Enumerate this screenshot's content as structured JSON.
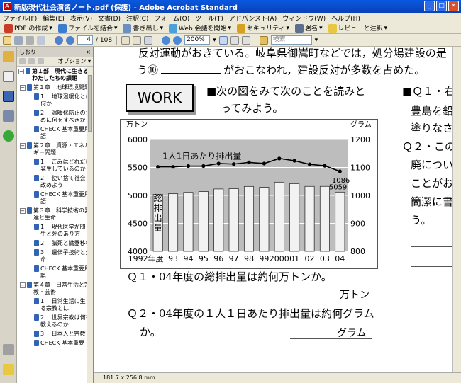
{
  "window": {
    "title": "新版現代社会演習ノート.pdf (保護) - Adobe Acrobat Standard",
    "buttons": [
      "_",
      "□",
      "×"
    ]
  },
  "menu": [
    "ファイル(F)",
    "編集(E)",
    "表示(V)",
    "文書(D)",
    "注釈(C)",
    "フォーム(O)",
    "ツール(T)",
    "アドバンスト(A)",
    "ウィンドウ(W)",
    "ヘルプ(H)"
  ],
  "toolbar1": {
    "pdf_create": "PDF の作成",
    "combine": "ファイルを結合",
    "export": "書き出し",
    "web_meeting": "Web 会議を開始",
    "security": "セキュリティ",
    "sign": "署名",
    "review": "レビューと注釈"
  },
  "toolbar2": {
    "page_current": "4",
    "page_total": "/ 108",
    "zoom": "200%",
    "search_placeholder": "検索"
  },
  "bookmarks": {
    "title": "しおり",
    "options": "オプション",
    "items": [
      {
        "level": 0,
        "text": "第１部　現代に生きるわたしたちの課題"
      },
      {
        "level": 1,
        "text": "第１章　地球環境問題"
      },
      {
        "level": 2,
        "text": "1.　地球温暖化とは何か"
      },
      {
        "level": 2,
        "text": "2.　温暖化防止のために何をすべきか"
      },
      {
        "level": 2,
        "text": "CHECK 基本重要用語"
      },
      {
        "level": 1,
        "text": "第２章　資源・エネルギー問題"
      },
      {
        "level": 2,
        "text": "1.　ごみはどれだけ発生しているのか"
      },
      {
        "level": 2,
        "text": "2.　使い捨て社会を改めよう"
      },
      {
        "level": 2,
        "text": "CHECK 基本重要用語"
      },
      {
        "level": 1,
        "text": "第３章　科学技術の発達と生命"
      },
      {
        "level": 2,
        "text": "1.　現代医学が問う生と死のあり方"
      },
      {
        "level": 2,
        "text": "2.　脳死と臓器移植"
      },
      {
        "level": 2,
        "text": "3.　遺伝子技術と生命"
      },
      {
        "level": 2,
        "text": "CHECK 基本重要用語"
      },
      {
        "level": 1,
        "text": "第４章　日常生活と宗教・芸術"
      },
      {
        "level": 2,
        "text": "1.　日常生活に生きる宗教とは"
      },
      {
        "level": 2,
        "text": "2.　世界宗教は何を教えるのか"
      },
      {
        "level": 2,
        "text": "3.　日本人と宗教"
      },
      {
        "level": 2,
        "text": "CHECK 基本重要"
      }
    ]
  },
  "status": {
    "page_size": "181.7 x 256.8 mm"
  },
  "document": {
    "line1": "反対運動がおきている。岐阜県御嵩町などでは，処分場建設の是",
    "line2_a": "う⑩",
    "line2_b": "がおこなわれ，建設反対が多数を占めた。",
    "work_label": "WORK",
    "task1_a": "■次の図をみて次のことを読みと",
    "task1_b": "ってみよう。",
    "right_col": [
      "■Ｑ１・右",
      "豊島を鉛",
      "塗りなさ",
      "Ｑ２・この",
      "廃につい",
      "ことがお",
      "簡潔に書",
      "う。"
    ],
    "q1": "Ｑ１・04年度の総排出量は約何万トンか。",
    "q1_unit": "万トン",
    "q2_a": "Ｑ２・04年度の１人１日あたり排出量は約何グラム",
    "q2_b": "か。",
    "q2_unit": "グラム"
  },
  "chart_data": {
    "type": "bar",
    "title": "",
    "categories": [
      "1992年度",
      "93",
      "94",
      "95",
      "96",
      "97",
      "98",
      "99",
      "2000",
      "01",
      "02",
      "03",
      "04"
    ],
    "y_left_label": "万トン",
    "y_right_label": "グラム",
    "y_left_ticks": [
      4000,
      4500,
      5000,
      5500,
      6000
    ],
    "y_right_ticks": [
      800,
      900,
      1000,
      1100,
      1200
    ],
    "ylim_left": [
      4000,
      6000
    ],
    "ylim_right": [
      800,
      1200
    ],
    "series": [
      {
        "name": "総排出量",
        "axis": "left",
        "type": "bar",
        "values": [
          5020,
          5030,
          5054,
          5069,
          5115,
          5120,
          5160,
          5145,
          5236,
          5210,
          5161,
          5161,
          5059
        ]
      },
      {
        "name": "１人１日あたり排出量",
        "axis": "right",
        "type": "line",
        "values": [
          1102,
          1102,
          1105,
          1105,
          1114,
          1112,
          1118,
          1114,
          1132,
          1124,
          1111,
          1106,
          1086
        ]
      }
    ],
    "data_labels": {
      "last_bar": "5059",
      "last_point": "1086"
    },
    "line_label": "1人1日あたり排出量",
    "bar_label": "総排出量",
    "colors": {
      "plot_bg": "#bdbdbd",
      "bar_fill": "#f2f2f2",
      "bar_stroke": "#333333",
      "line": "#000000"
    }
  }
}
